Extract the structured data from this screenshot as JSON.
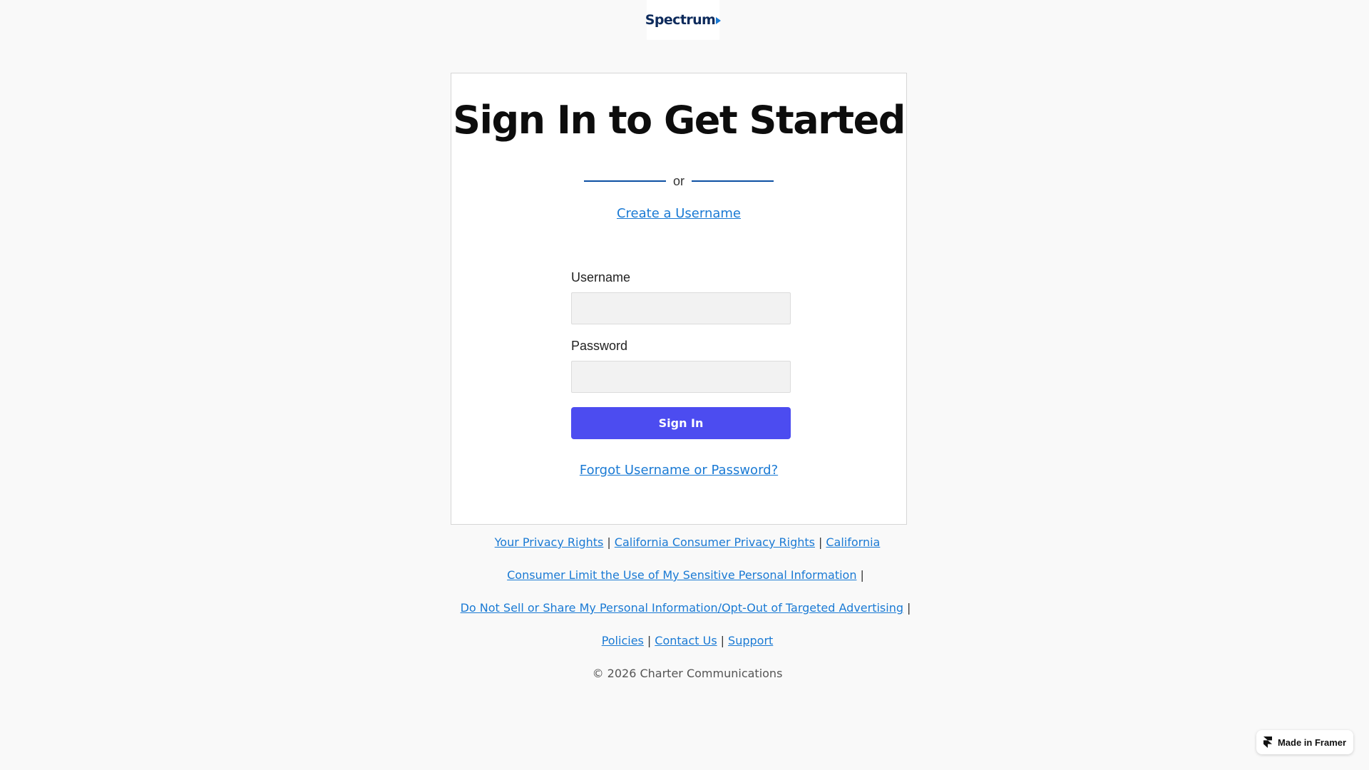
{
  "header": {
    "logo_text": "Spectrum"
  },
  "signin": {
    "title": "Sign In to Get Started",
    "divider_text": "or",
    "create_username": "Create a Username",
    "username_label": "Username",
    "username_value": "",
    "password_label": "Password",
    "password_value": "",
    "signin_button": "Sign In",
    "forgot_link": "Forgot Username or Password?"
  },
  "footer": {
    "links": {
      "privacy_rights": "Your Privacy Rights",
      "ca_privacy_rights": "California Consumer Privacy Rights",
      "ca_limit_part1": "California",
      "ca_limit_part2": "Consumer Limit the Use of My Sensitive Personal Information",
      "do_not_sell": "Do Not Sell or Share My Personal Information/Opt-Out of Targeted Advertising",
      "policies": "Policies",
      "contact_us": "Contact Us",
      "support": "Support"
    },
    "separator": "|",
    "copyright": "© 2026 Charter Communications"
  },
  "badge": {
    "label": "Made in Framer",
    "icon": "framer-icon"
  },
  "colors": {
    "primary_button": "#4c4cf0",
    "link": "#1a7ad4",
    "divider": "#0c4fa3",
    "background": "#f9f9f9"
  }
}
